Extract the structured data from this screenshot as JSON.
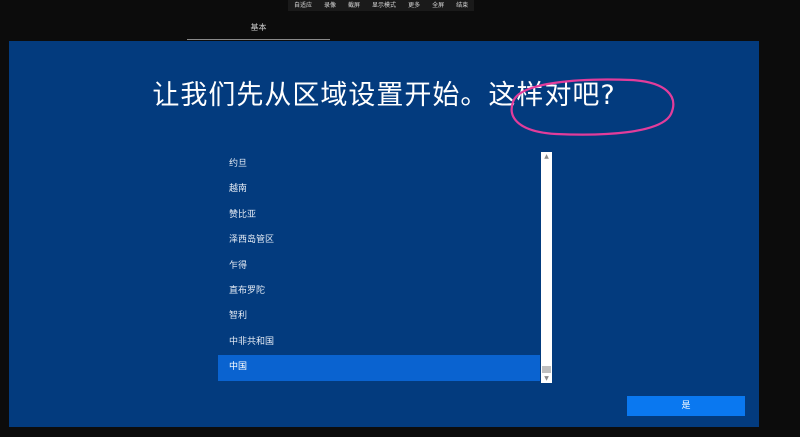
{
  "toolbar": {
    "items": [
      "自适应",
      "录像",
      "截屏",
      "显示模式",
      "更多",
      "全屏",
      "结束"
    ]
  },
  "tab": {
    "label": "基本"
  },
  "oobe": {
    "title": "让我们先从区域设置开始。这样对吧?",
    "regions": [
      "约旦",
      "越南",
      "赞比亚",
      "泽西岛管区",
      "乍得",
      "直布罗陀",
      "智利",
      "中非共和国",
      "中国"
    ],
    "selected_region": "中国",
    "yes_button": "是"
  },
  "colors": {
    "background": "#033b7e",
    "selected": "#0a63d0",
    "button": "#0a78f0",
    "annotation": "#e23c9b"
  }
}
